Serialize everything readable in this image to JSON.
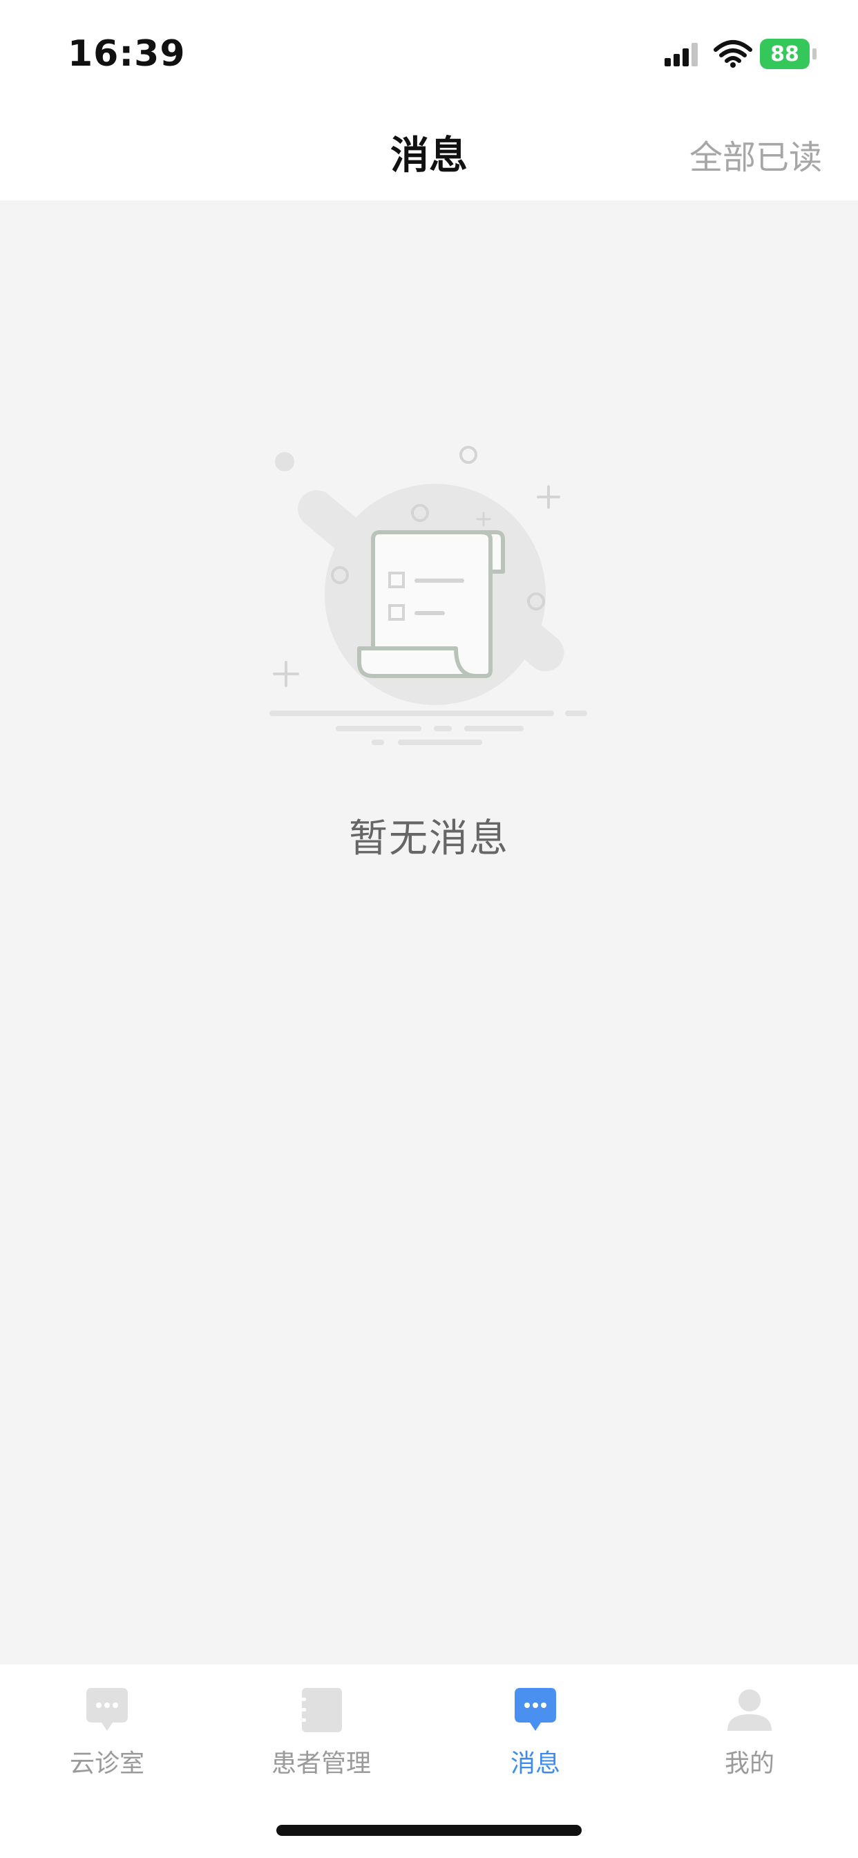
{
  "status_bar": {
    "time": "16:39",
    "battery": "88",
    "icons": [
      "signal-icon",
      "wifi-icon",
      "battery-charging-icon"
    ]
  },
  "header": {
    "title": "消息",
    "mark_all_read": "全部已读"
  },
  "empty_state": {
    "icon": "empty-scroll-illustration",
    "message": "暂无消息"
  },
  "tab_bar": {
    "active_color": "#3d8bf0",
    "inactive_color": "#9a9a9a",
    "items": [
      {
        "label": "云诊室",
        "icon": "chat-bubble-icon",
        "active": false
      },
      {
        "label": "患者管理",
        "icon": "notebook-icon",
        "active": false
      },
      {
        "label": "消息",
        "icon": "message-icon",
        "active": true
      },
      {
        "label": "我的",
        "icon": "person-icon",
        "active": false
      }
    ]
  }
}
